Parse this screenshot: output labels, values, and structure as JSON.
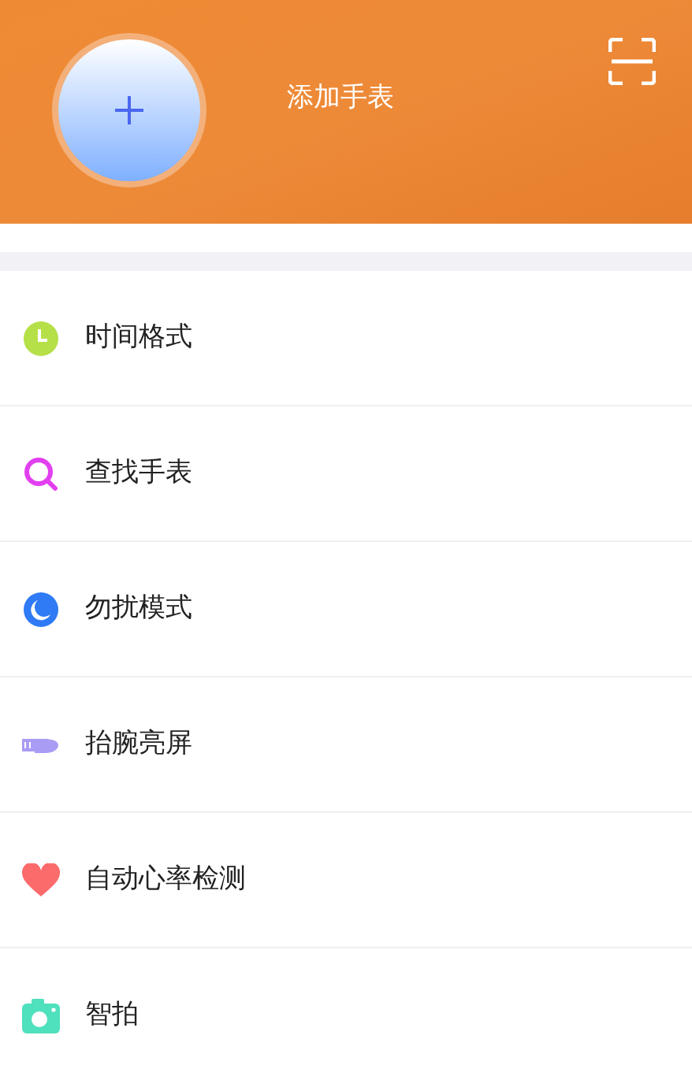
{
  "header": {
    "add_label": "添加手表"
  },
  "menu": [
    {
      "kind": "clock",
      "label": "时间格式"
    },
    {
      "kind": "search",
      "label": "查找手表"
    },
    {
      "kind": "moon",
      "label": "勿扰模式"
    },
    {
      "kind": "wrist",
      "label": "抬腕亮屏"
    },
    {
      "kind": "heart",
      "label": "自动心率检测"
    },
    {
      "kind": "camera",
      "label": "智拍"
    }
  ]
}
